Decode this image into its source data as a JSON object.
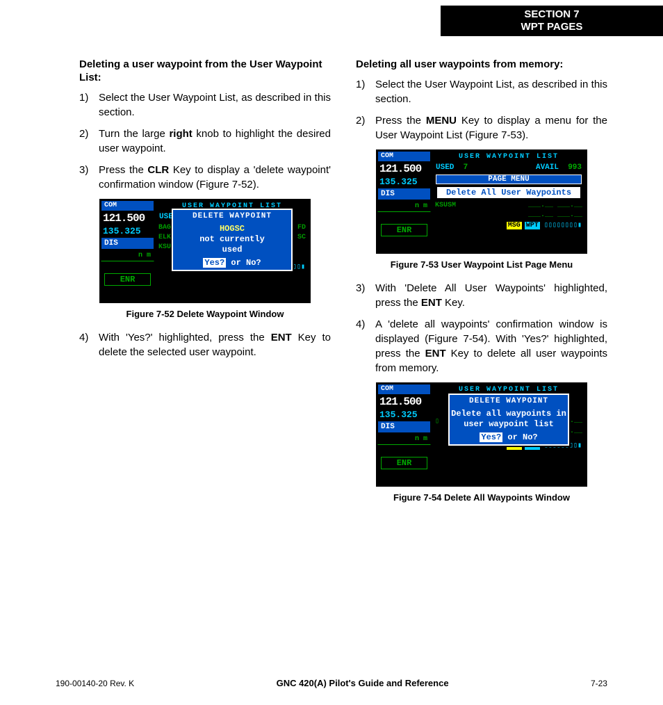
{
  "header": {
    "line1": "SECTION 7",
    "line2": "WPT PAGES"
  },
  "left": {
    "heading": "Deleting a user waypoint from the User Waypoint List:",
    "steps": [
      {
        "n": "1)",
        "html": "Select the User Waypoint List, as described in this section."
      },
      {
        "n": "2)",
        "html": "Turn the large <b>right</b> knob to highlight the desired user waypoint."
      },
      {
        "n": "3)",
        "html": "Press the <b>CLR</b> Key to display a 'delete waypoint' confirmation window (Figure 7-52)."
      }
    ],
    "fig_caption": "Figure 7-52  Delete Waypoint Window",
    "step4": {
      "n": "4)",
      "html": "With 'Yes?' highlighted, press the <b>ENT</b> Key to delete the selected user waypoint."
    }
  },
  "right": {
    "heading": "Deleting all user waypoints from memory:",
    "steps_a": [
      {
        "n": "1)",
        "html": "Select the User Waypoint List, as described in this section."
      },
      {
        "n": "2)",
        "html": "Press the <b>MENU</b> Key to display a menu for the User Waypoint List (Figure 7-53)."
      }
    ],
    "fig53_caption": "Figure 7-53  User Waypoint List Page Menu",
    "steps_b": [
      {
        "n": "3)",
        "html": "With 'Delete All User Waypoints' highlighted, press the <b>ENT</b> Key."
      },
      {
        "n": "4)",
        "html": "A 'delete all waypoints' confirmation window is displayed (Figure 7-54). With 'Yes?' highlighted, press the <b>ENT</b> Key to delete all user waypoints from memory."
      }
    ],
    "fig54_caption": "Figure 7-54  Delete All Waypoints Window"
  },
  "device_common": {
    "com_label": "COM",
    "freq_active": "121.500",
    "freq_standby": "135.325",
    "dis_label": "DIS",
    "nm": "n m",
    "enr": "ENR",
    "title": "USER WAYPOINT LIST",
    "msg": "MSG",
    "wpt": "WPT"
  },
  "fig52": {
    "popup_title": "DELETE WAYPOINT",
    "name": "HOGSC",
    "line1": "not currently",
    "line2": "used",
    "yes": "Yes?",
    "or": " or ",
    "no": "No?",
    "bg_rows": [
      "BAG",
      "ELK",
      "KSU"
    ],
    "bg_right": [
      "FD",
      "SC",
      ""
    ]
  },
  "fig53": {
    "used_label": "USED",
    "used_val": "7",
    "avail_label": "AVAIL",
    "avail_val": "993",
    "page_menu": "PAGE MENU",
    "menu_item": "Delete All User Waypoints",
    "row2_left": "KSUSM"
  },
  "fig54": {
    "popup_title": "DELETE WAYPOINT",
    "line1": "Delete all waypoints in",
    "line2": "user waypoint list",
    "yes": "Yes?",
    "or": " or ",
    "no": "No?"
  },
  "footer": {
    "left": "190-00140-20  Rev. K",
    "center": "GNC 420(A) Pilot's Guide and Reference",
    "right": "7-23"
  }
}
